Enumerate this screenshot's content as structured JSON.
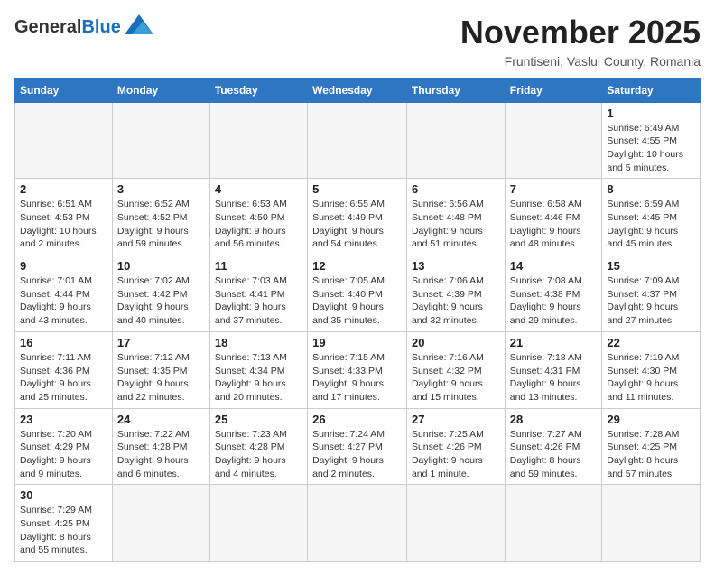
{
  "header": {
    "logo_general": "General",
    "logo_blue": "Blue",
    "month_title": "November 2025",
    "location": "Fruntiseni, Vaslui County, Romania"
  },
  "weekdays": [
    "Sunday",
    "Monday",
    "Tuesday",
    "Wednesday",
    "Thursday",
    "Friday",
    "Saturday"
  ],
  "weeks": [
    [
      {
        "day": "",
        "info": ""
      },
      {
        "day": "",
        "info": ""
      },
      {
        "day": "",
        "info": ""
      },
      {
        "day": "",
        "info": ""
      },
      {
        "day": "",
        "info": ""
      },
      {
        "day": "",
        "info": ""
      },
      {
        "day": "1",
        "info": "Sunrise: 6:49 AM\nSunset: 4:55 PM\nDaylight: 10 hours and 5 minutes."
      }
    ],
    [
      {
        "day": "2",
        "info": "Sunrise: 6:51 AM\nSunset: 4:53 PM\nDaylight: 10 hours and 2 minutes."
      },
      {
        "day": "3",
        "info": "Sunrise: 6:52 AM\nSunset: 4:52 PM\nDaylight: 9 hours and 59 minutes."
      },
      {
        "day": "4",
        "info": "Sunrise: 6:53 AM\nSunset: 4:50 PM\nDaylight: 9 hours and 56 minutes."
      },
      {
        "day": "5",
        "info": "Sunrise: 6:55 AM\nSunset: 4:49 PM\nDaylight: 9 hours and 54 minutes."
      },
      {
        "day": "6",
        "info": "Sunrise: 6:56 AM\nSunset: 4:48 PM\nDaylight: 9 hours and 51 minutes."
      },
      {
        "day": "7",
        "info": "Sunrise: 6:58 AM\nSunset: 4:46 PM\nDaylight: 9 hours and 48 minutes."
      },
      {
        "day": "8",
        "info": "Sunrise: 6:59 AM\nSunset: 4:45 PM\nDaylight: 9 hours and 45 minutes."
      }
    ],
    [
      {
        "day": "9",
        "info": "Sunrise: 7:01 AM\nSunset: 4:44 PM\nDaylight: 9 hours and 43 minutes."
      },
      {
        "day": "10",
        "info": "Sunrise: 7:02 AM\nSunset: 4:42 PM\nDaylight: 9 hours and 40 minutes."
      },
      {
        "day": "11",
        "info": "Sunrise: 7:03 AM\nSunset: 4:41 PM\nDaylight: 9 hours and 37 minutes."
      },
      {
        "day": "12",
        "info": "Sunrise: 7:05 AM\nSunset: 4:40 PM\nDaylight: 9 hours and 35 minutes."
      },
      {
        "day": "13",
        "info": "Sunrise: 7:06 AM\nSunset: 4:39 PM\nDaylight: 9 hours and 32 minutes."
      },
      {
        "day": "14",
        "info": "Sunrise: 7:08 AM\nSunset: 4:38 PM\nDaylight: 9 hours and 29 minutes."
      },
      {
        "day": "15",
        "info": "Sunrise: 7:09 AM\nSunset: 4:37 PM\nDaylight: 9 hours and 27 minutes."
      }
    ],
    [
      {
        "day": "16",
        "info": "Sunrise: 7:11 AM\nSunset: 4:36 PM\nDaylight: 9 hours and 25 minutes."
      },
      {
        "day": "17",
        "info": "Sunrise: 7:12 AM\nSunset: 4:35 PM\nDaylight: 9 hours and 22 minutes."
      },
      {
        "day": "18",
        "info": "Sunrise: 7:13 AM\nSunset: 4:34 PM\nDaylight: 9 hours and 20 minutes."
      },
      {
        "day": "19",
        "info": "Sunrise: 7:15 AM\nSunset: 4:33 PM\nDaylight: 9 hours and 17 minutes."
      },
      {
        "day": "20",
        "info": "Sunrise: 7:16 AM\nSunset: 4:32 PM\nDaylight: 9 hours and 15 minutes."
      },
      {
        "day": "21",
        "info": "Sunrise: 7:18 AM\nSunset: 4:31 PM\nDaylight: 9 hours and 13 minutes."
      },
      {
        "day": "22",
        "info": "Sunrise: 7:19 AM\nSunset: 4:30 PM\nDaylight: 9 hours and 11 minutes."
      }
    ],
    [
      {
        "day": "23",
        "info": "Sunrise: 7:20 AM\nSunset: 4:29 PM\nDaylight: 9 hours and 9 minutes."
      },
      {
        "day": "24",
        "info": "Sunrise: 7:22 AM\nSunset: 4:28 PM\nDaylight: 9 hours and 6 minutes."
      },
      {
        "day": "25",
        "info": "Sunrise: 7:23 AM\nSunset: 4:28 PM\nDaylight: 9 hours and 4 minutes."
      },
      {
        "day": "26",
        "info": "Sunrise: 7:24 AM\nSunset: 4:27 PM\nDaylight: 9 hours and 2 minutes."
      },
      {
        "day": "27",
        "info": "Sunrise: 7:25 AM\nSunset: 4:26 PM\nDaylight: 9 hours and 1 minute."
      },
      {
        "day": "28",
        "info": "Sunrise: 7:27 AM\nSunset: 4:26 PM\nDaylight: 8 hours and 59 minutes."
      },
      {
        "day": "29",
        "info": "Sunrise: 7:28 AM\nSunset: 4:25 PM\nDaylight: 8 hours and 57 minutes."
      }
    ],
    [
      {
        "day": "30",
        "info": "Sunrise: 7:29 AM\nSunset: 4:25 PM\nDaylight: 8 hours and 55 minutes."
      },
      {
        "day": "",
        "info": ""
      },
      {
        "day": "",
        "info": ""
      },
      {
        "day": "",
        "info": ""
      },
      {
        "day": "",
        "info": ""
      },
      {
        "day": "",
        "info": ""
      },
      {
        "day": "",
        "info": ""
      }
    ]
  ]
}
